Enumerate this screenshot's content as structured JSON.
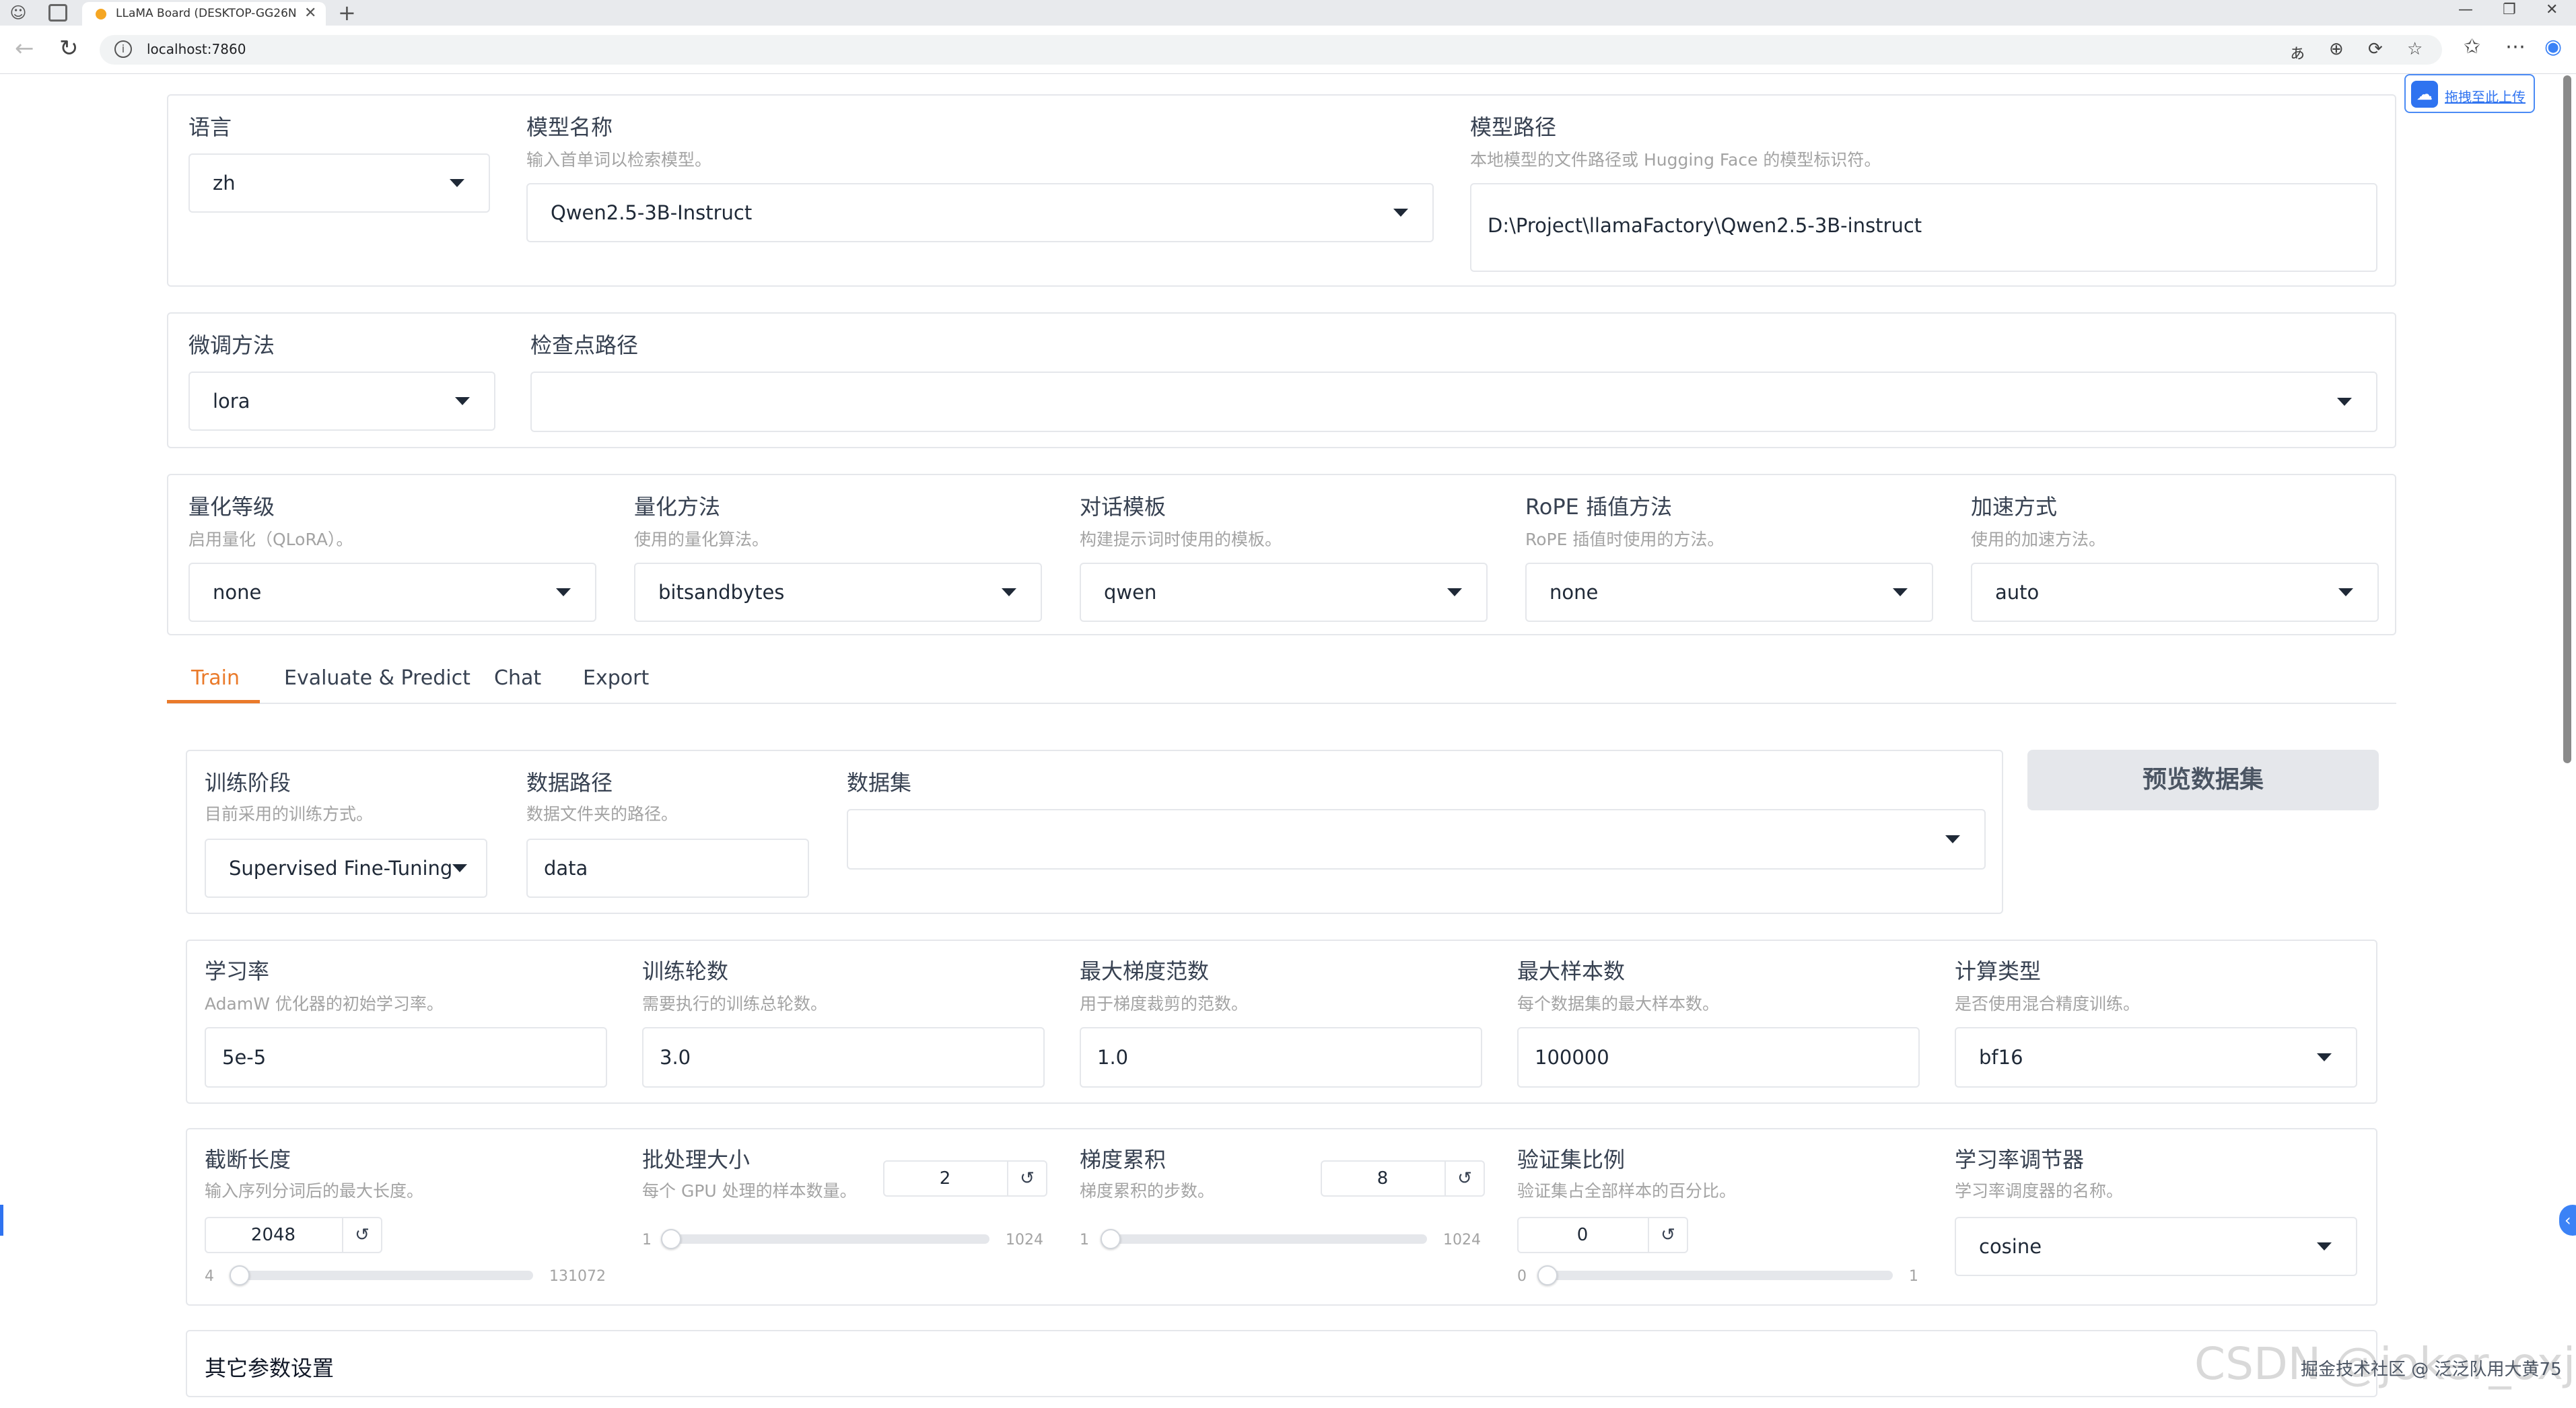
{
  "browser": {
    "tab_title": "LLaMA Board (DESKTOP-GG26N...",
    "url": "localhost:7860"
  },
  "upload_button": "拖拽至此上传",
  "model": {
    "lang_label": "语言",
    "lang_value": "zh",
    "name_label": "模型名称",
    "name_desc": "输入首单词以检索模型。",
    "name_value": "Qwen2.5-3B-Instruct",
    "path_label": "模型路径",
    "path_desc": "本地模型的文件路径或 Hugging Face 的模型标识符。",
    "path_value": "D:\\Project\\llamaFactory\\Qwen2.5-3B-instruct"
  },
  "finetune": {
    "method_label": "微调方法",
    "method_value": "lora",
    "ckpt_label": "检查点路径",
    "ckpt_value": ""
  },
  "advanced": {
    "quant_bit_label": "量化等级",
    "quant_bit_desc": "启用量化（QLoRA）。",
    "quant_bit_value": "none",
    "quant_method_label": "量化方法",
    "quant_method_desc": "使用的量化算法。",
    "quant_method_value": "bitsandbytes",
    "template_label": "对话模板",
    "template_desc": "构建提示词时使用的模板。",
    "template_value": "qwen",
    "rope_label": "RoPE 插值方法",
    "rope_desc": "RoPE 插值时使用的方法。",
    "rope_value": "none",
    "booster_label": "加速方式",
    "booster_desc": "使用的加速方法。",
    "booster_value": "auto"
  },
  "tabs": [
    "Train",
    "Evaluate & Predict",
    "Chat",
    "Export"
  ],
  "train": {
    "stage_label": "训练阶段",
    "stage_desc": "目前采用的训练方式。",
    "stage_value": "Supervised Fine-Tuning",
    "dir_label": "数据路径",
    "dir_desc": "数据文件夹的路径。",
    "dir_value": "data",
    "dataset_label": "数据集",
    "dataset_value": "",
    "preview_button": "预览数据集",
    "lr_label": "学习率",
    "lr_desc": "AdamW 优化器的初始学习率。",
    "lr_value": "5e-5",
    "epochs_label": "训练轮数",
    "epochs_desc": "需要执行的训练总轮数。",
    "epochs_value": "3.0",
    "grad_norm_label": "最大梯度范数",
    "grad_norm_desc": "用于梯度裁剪的范数。",
    "grad_norm_value": "1.0",
    "max_samples_label": "最大样本数",
    "max_samples_desc": "每个数据集的最大样本数。",
    "max_samples_value": "100000",
    "compute_label": "计算类型",
    "compute_desc": "是否使用混合精度训练。",
    "compute_value": "bf16",
    "cutoff_label": "截断长度",
    "cutoff_desc": "输入序列分词后的最大长度。",
    "cutoff_value": "2048",
    "cutoff_min": "4",
    "cutoff_max": "131072",
    "cutoff_fraction": 0.0156,
    "batch_label": "批处理大小",
    "batch_desc": "每个 GPU 处理的样本数量。",
    "batch_value": "2",
    "batch_min": "1",
    "batch_max": "1024",
    "batch_fraction": 0.001,
    "accum_label": "梯度累积",
    "accum_desc": "梯度累积的步数。",
    "accum_value": "8",
    "accum_min": "1",
    "accum_max": "1024",
    "accum_fraction": 0.007,
    "val_label": "验证集比例",
    "val_desc": "验证集占全部样本的百分比。",
    "val_value": "0",
    "val_min": "0",
    "val_max": "1",
    "val_fraction": 0,
    "scheduler_label": "学习率调节器",
    "scheduler_desc": "学习率调度器的名称。",
    "scheduler_value": "cosine",
    "extra_label": "其它参数设置"
  },
  "reset_glyph": "↺",
  "watermark": "CSDN @joker_oxj",
  "watermark_small": "掘金技术社区 @ 泛泛队用大黄75"
}
